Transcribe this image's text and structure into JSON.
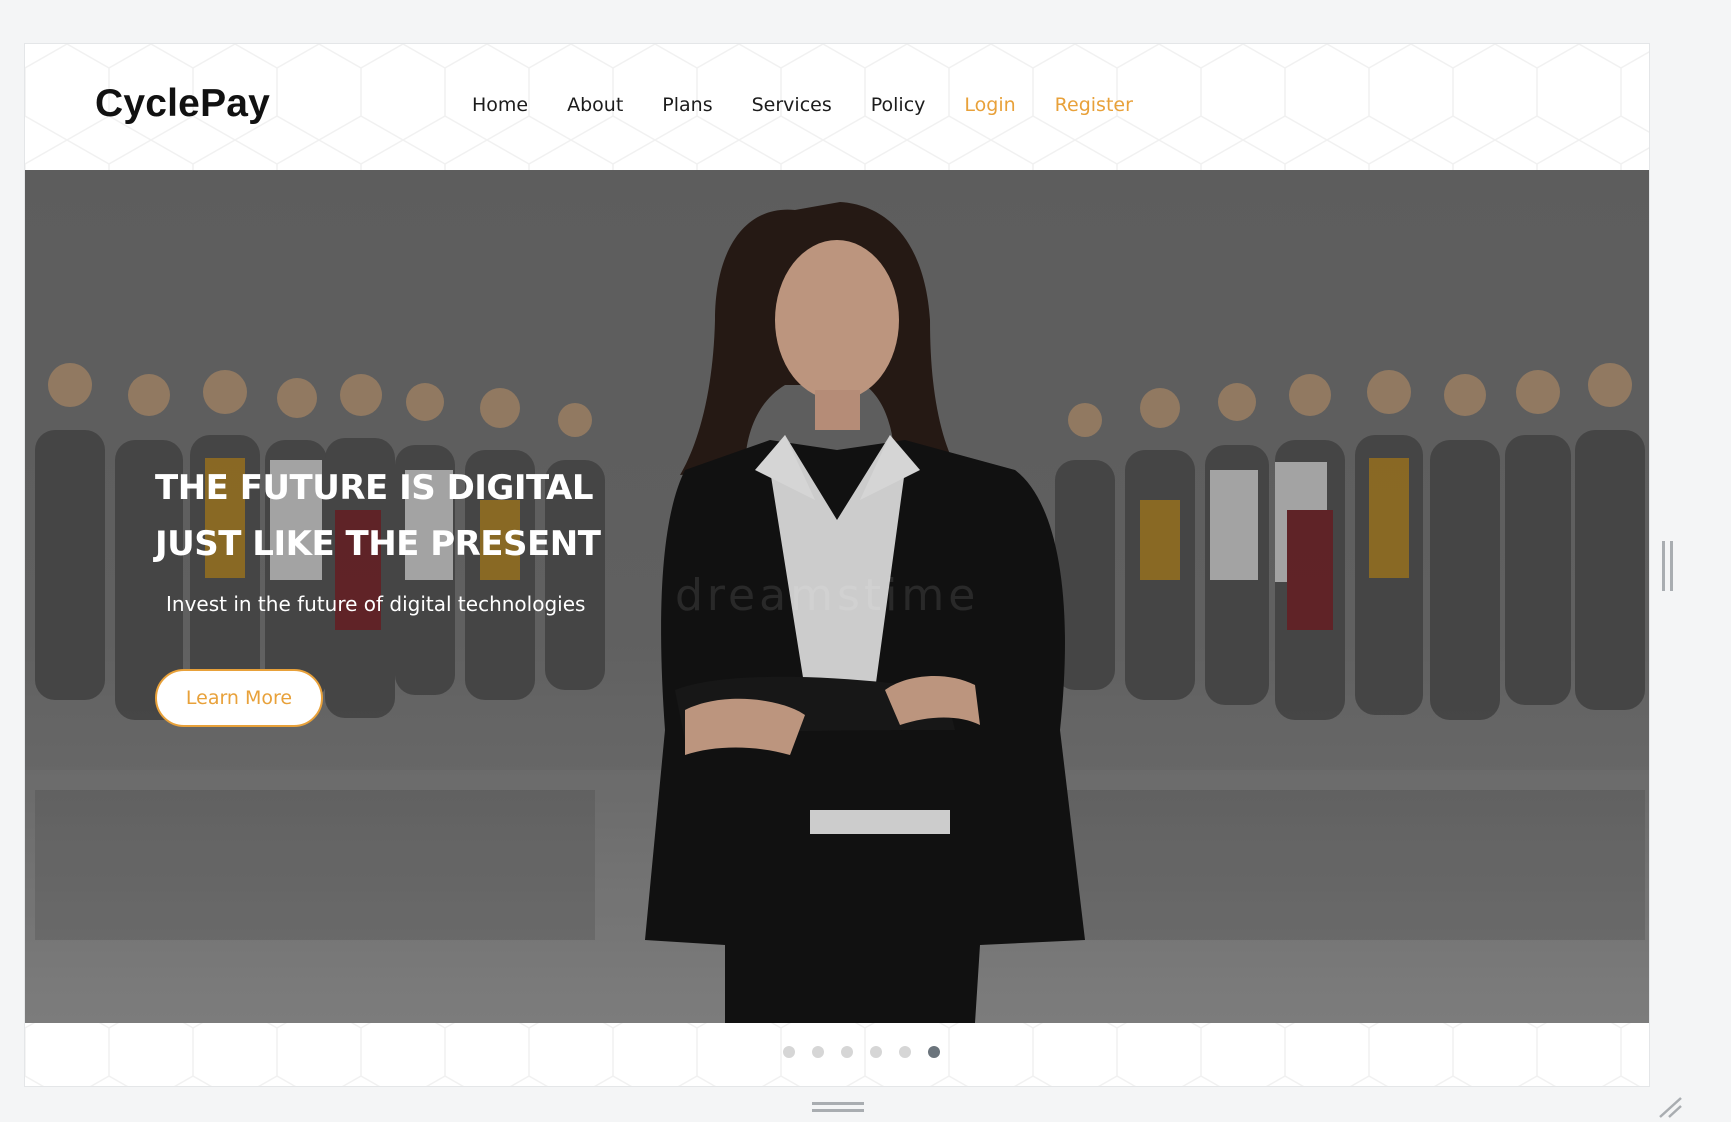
{
  "brand": {
    "name": "CyclePay"
  },
  "nav": {
    "items": [
      {
        "label": "Home",
        "accent": false
      },
      {
        "label": "About",
        "accent": false
      },
      {
        "label": "Plans",
        "accent": false
      },
      {
        "label": "Services",
        "accent": false
      },
      {
        "label": "Policy",
        "accent": false
      },
      {
        "label": "Login",
        "accent": true
      },
      {
        "label": "Register",
        "accent": true
      }
    ]
  },
  "hero": {
    "title_line1": "THE FUTURE IS DIGITAL",
    "title_line2": "JUST LIKE THE PRESENT",
    "subtitle": "Invest in the future of digital technologies",
    "cta_label": "Learn More",
    "watermark": "dreamstime"
  },
  "carousel": {
    "slide_count": 6,
    "active_index": 5
  },
  "colors": {
    "accent": "#e8a13a",
    "text_dark": "#111111",
    "dot_inactive": "#d6d6d6",
    "dot_active": "#6b747c"
  }
}
